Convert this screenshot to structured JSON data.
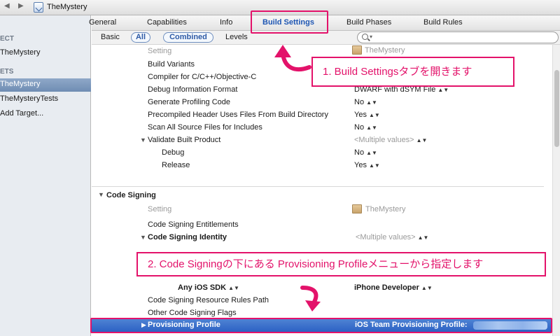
{
  "window": {
    "title": "TheMystery"
  },
  "navbar": {
    "back_arrow": "◀",
    "forward_arrow": "▶"
  },
  "sidebar": {
    "project_header": "ECT",
    "project_item": "TheMystery",
    "targets_header": "ETS",
    "targets": [
      {
        "label": "TheMystery",
        "selected": true
      },
      {
        "label": "TheMysteryTests",
        "selected": false
      }
    ],
    "add_target": "Add Target..."
  },
  "tabs": [
    {
      "label": "General",
      "active": false
    },
    {
      "label": "Capabilities",
      "active": false
    },
    {
      "label": "Info",
      "active": false
    },
    {
      "label": "Build Settings",
      "active": true
    },
    {
      "label": "Build Phases",
      "active": false
    },
    {
      "label": "Build Rules",
      "active": false
    }
  ],
  "filters": {
    "basic": "Basic",
    "all": "All",
    "combined": "Combined",
    "levels": "Levels",
    "search_placeholder": ""
  },
  "build_options": {
    "setting_header": "Setting",
    "target_header": "TheMystery",
    "rows": [
      {
        "label": "Build Variants",
        "value": ""
      },
      {
        "label": "Compiler for C/C++/Objective-C",
        "value": ""
      },
      {
        "label": "Debug Information Format",
        "value": "DWARF with dSYM File"
      },
      {
        "label": "Generate Profiling Code",
        "value": "No"
      },
      {
        "label": "Precompiled Header Uses Files From Build Directory",
        "value": "Yes"
      },
      {
        "label": "Scan All Source Files for Includes",
        "value": "No"
      },
      {
        "label": "Validate Built Product",
        "value": "<Multiple values>"
      },
      {
        "label": "Debug",
        "value": "No"
      },
      {
        "label": "Release",
        "value": "Yes"
      }
    ]
  },
  "code_signing": {
    "section_title": "Code Signing",
    "setting_header": "Setting",
    "target_header": "TheMystery",
    "entitlements": "Code Signing Entitlements",
    "identity_label": "Code Signing Identity",
    "identity_value": "<Multiple values>",
    "any_ios_sdk_label": "Any iOS SDK",
    "any_ios_sdk_value": "iPhone Developer",
    "resource_rules": "Code Signing Resource Rules Path",
    "other_flags": "Other Code Signing Flags",
    "provisioning_label": "Provisioning Profile",
    "provisioning_value": "iOS Team Provisioning Profile:"
  },
  "annotations": {
    "callout1": "1. Build Settingsタブを開きます",
    "callout2": "2. Code Signingの下にある Provisioning Profileメニューから指定します"
  },
  "colors": {
    "annotation": "#e3126a",
    "selection": "#2c62c4",
    "active_tab": "#1e56b3"
  }
}
